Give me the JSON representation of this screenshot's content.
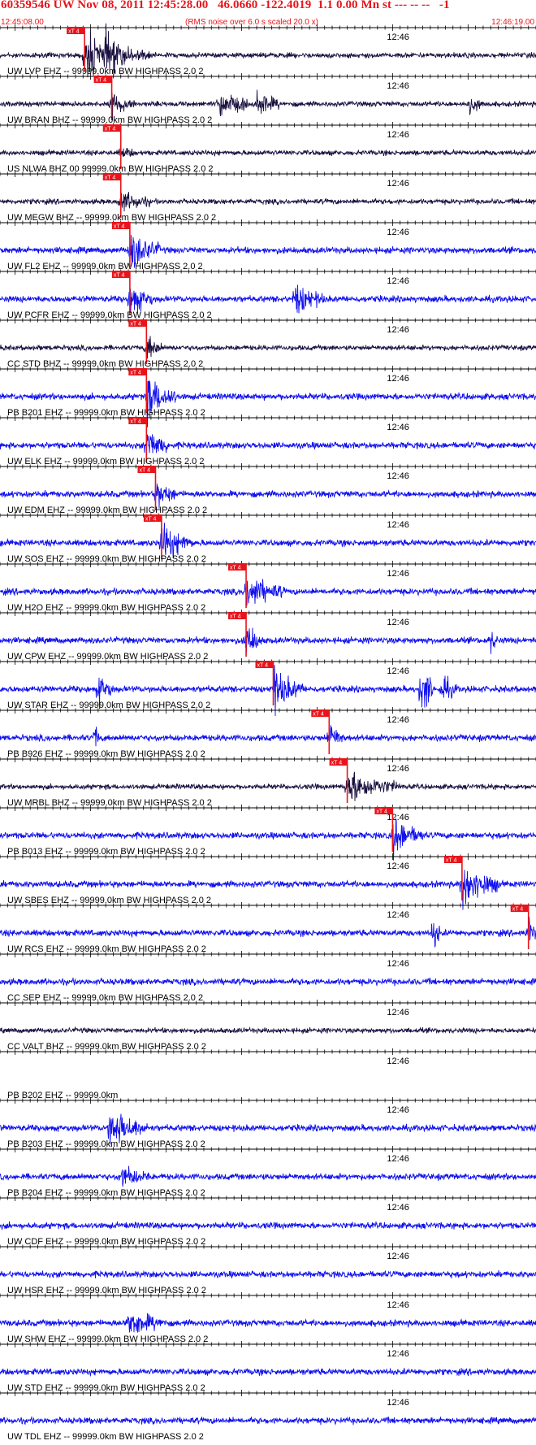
{
  "header": {
    "title": "60359546 UW Nov 08, 2011 12:45:28.00   46.0660 -122.4019  1.1 0.00 Mn st --- -- --   -1",
    "start_time": "12:45:08.00",
    "rms_note": "(RMS noise over 6.0 s scaled 20.0 x)",
    "end_time": "12:46:19.00"
  },
  "colors": {
    "header_text": "#e8141b",
    "trace_blue": "#1010ee",
    "trace_dark": "#1a1040",
    "pick_marker": "#e8141b",
    "axis": "#000000"
  },
  "chart_data": {
    "type": "seismogram",
    "x_unit": "seconds after 12:45:08.00",
    "xlim": [
      0,
      71
    ],
    "minor_tick_interval_s": 1,
    "major_tick_interval_s": 10,
    "time_mark": {
      "label": "12:46",
      "t": 52
    },
    "pick_label": "xT 4",
    "traces": [
      {
        "label": "UW LVP EHZ -- 99999.0km BW  HIGHPASS  2.0  2",
        "color": "dark",
        "pick_t": 11.2,
        "burst": [
          [
            11.2,
            4,
            2.6
          ],
          [
            14,
            6,
            1.4
          ]
        ]
      },
      {
        "label": "UW BRAN BHZ -- 99999.0km BW  HIGHPASS  2.0  2",
        "color": "dark",
        "pick_t": 14.8,
        "burst": [
          [
            14.8,
            3,
            1.2
          ],
          [
            29,
            4,
            1.4
          ],
          [
            34,
            3,
            1.3
          ],
          [
            62,
            2,
            0.9
          ]
        ]
      },
      {
        "label": "US NLWA BHZ 00 99999.0km BW  HIGHPASS  2.0  2",
        "color": "dark",
        "pick_t": 16.0,
        "burst": [
          [
            16,
            2,
            0.5
          ]
        ]
      },
      {
        "label": "UW MEGW BHZ -- 99999.0km BW  HIGHPASS  2.0  2",
        "color": "dark",
        "pick_t": 16.0,
        "burst": [
          [
            16,
            4,
            1.0
          ]
        ]
      },
      {
        "label": "UW FL2 EHZ -- 99999.0km BW  HIGHPASS  2.0  2",
        "color": "blue",
        "pick_t": 17.2,
        "burst": [
          [
            17.2,
            4,
            1.6
          ]
        ]
      },
      {
        "label": "UW PCFR EHZ -- 99999.0km BW  HIGHPASS  2.0  2",
        "color": "blue",
        "pick_t": 17.2,
        "burst": [
          [
            17.2,
            3,
            1.3
          ],
          [
            39,
            4,
            1.2
          ]
        ]
      },
      {
        "label": "CC STD BHZ -- 99999.0km BW  HIGHPASS  2.0  2",
        "color": "dark",
        "pick_t": 19.4,
        "burst": [
          [
            19.4,
            2,
            1.4
          ]
        ]
      },
      {
        "label": "PB B201 EHZ -- 99999.0km BW  HIGHPASS  2.0  2",
        "color": "blue",
        "pick_t": 19.4,
        "burst": [
          [
            19.4,
            4,
            1.8
          ]
        ]
      },
      {
        "label": "UW ELK EHZ -- 99999.0km BW  HIGHPASS  2.0  2",
        "color": "blue",
        "pick_t": 19.4,
        "burst": [
          [
            19.4,
            3,
            1.4
          ]
        ]
      },
      {
        "label": "UW EDM EHZ -- 99999.0km BW  HIGHPASS  2.0  2",
        "color": "blue",
        "pick_t": 20.6,
        "burst": [
          [
            20.6,
            3,
            1.0
          ]
        ]
      },
      {
        "label": "UW SOS EHZ -- 99999.0km BW  HIGHPASS  2.0  2",
        "color": "blue",
        "pick_t": 21.4,
        "burst": [
          [
            21.4,
            4,
            1.6
          ]
        ]
      },
      {
        "label": "UW H2O EHZ -- 99999.0km BW  HIGHPASS  2.0  2",
        "color": "blue",
        "pick_t": 32.6,
        "burst": [
          [
            32.6,
            5,
            1.4
          ]
        ]
      },
      {
        "label": "UW CPW EHZ -- 99999.0km BW  HIGHPASS  2.0  2",
        "color": "blue",
        "pick_t": 32.6,
        "burst": [
          [
            32.6,
            2,
            1.5
          ],
          [
            65,
            1,
            0.8
          ]
        ]
      },
      {
        "label": "UW STAR EHZ -- 99999.0km BW  HIGHPASS  2.0  2",
        "color": "blue",
        "pick_t": 36.2,
        "burst": [
          [
            13,
            2,
            1.2
          ],
          [
            36.2,
            4,
            1.6
          ],
          [
            55.8,
            1.5,
            2.6
          ],
          [
            58.5,
            2,
            1.0
          ]
        ]
      },
      {
        "label": "PB B926 EHZ -- 99999.0km BW  HIGHPASS  2.0  2",
        "color": "blue",
        "pick_t": 43.6,
        "burst": [
          [
            12.6,
            0.5,
            1.2
          ],
          [
            43.6,
            2,
            1.1
          ]
        ]
      },
      {
        "label": "UW MRBL BHZ -- 99999.0km BW  HIGHPASS  2.0  2",
        "color": "dark",
        "pick_t": 46.0,
        "burst": [
          [
            46,
            7,
            1.6
          ]
        ]
      },
      {
        "label": "PB B013 EHZ -- 99999.0km BW  HIGHPASS  2.0  2",
        "color": "blue",
        "pick_t": 52.0,
        "burst": [
          [
            52,
            4,
            1.5
          ]
        ]
      },
      {
        "label": "UW SBES EHZ -- 99999.0km BW  HIGHPASS  2.0  2",
        "color": "blue",
        "pick_t": 61.2,
        "burst": [
          [
            61.2,
            5,
            1.9
          ]
        ]
      },
      {
        "label": "UW RCS EHZ -- 99999.0km BW  HIGHPASS  2.0  2",
        "color": "blue",
        "pick_t": 70.0,
        "burst": [
          [
            57.4,
            1,
            1.3
          ],
          [
            70,
            1,
            1.2
          ]
        ]
      },
      {
        "label": "CC SEP EHZ -- 99999.0km BW  HIGHPASS  2.0  2",
        "color": "blue",
        "pick_t": null,
        "burst": []
      },
      {
        "label": "CC VALT BHZ -- 99999.0km BW  HIGHPASS  2.0  2",
        "color": "dark",
        "pick_t": null,
        "burst": []
      },
      {
        "label": "PB B202 EHZ -- 99999.0km",
        "color": "blue",
        "pick_t": null,
        "flat": true,
        "burst": []
      },
      {
        "label": "PB B203 EHZ -- 99999.0km BW  HIGHPASS  2.0  2",
        "color": "blue",
        "pick_t": null,
        "burst": [
          [
            14.5,
            5,
            1.6
          ]
        ]
      },
      {
        "label": "PB B204 EHZ -- 99999.0km BW  HIGHPASS  2.0  2",
        "color": "blue",
        "pick_t": null,
        "burst": [
          [
            16,
            4,
            0.8
          ]
        ]
      },
      {
        "label": "UW CDF EHZ -- 99999.0km BW  HIGHPASS  2.0  2",
        "color": "blue",
        "pick_t": null,
        "burst": []
      },
      {
        "label": "UW HSR EHZ -- 99999.0km BW  HIGHPASS  2.0  2",
        "color": "blue",
        "pick_t": null,
        "burst": []
      },
      {
        "label": "UW SHW EHZ -- 99999.0km BW  HIGHPASS  2.0  2",
        "color": "blue",
        "pick_t": null,
        "burst": [
          [
            17,
            5,
            1.1
          ]
        ]
      },
      {
        "label": "UW STD EHZ -- 99999.0km BW  HIGHPASS  2.0  2",
        "color": "blue",
        "pick_t": null,
        "burst": []
      },
      {
        "label": "UW TDL EHZ -- 99999.0km BW  HIGHPASS  2.0  2",
        "color": "blue",
        "pick_t": null,
        "burst": []
      }
    ]
  }
}
